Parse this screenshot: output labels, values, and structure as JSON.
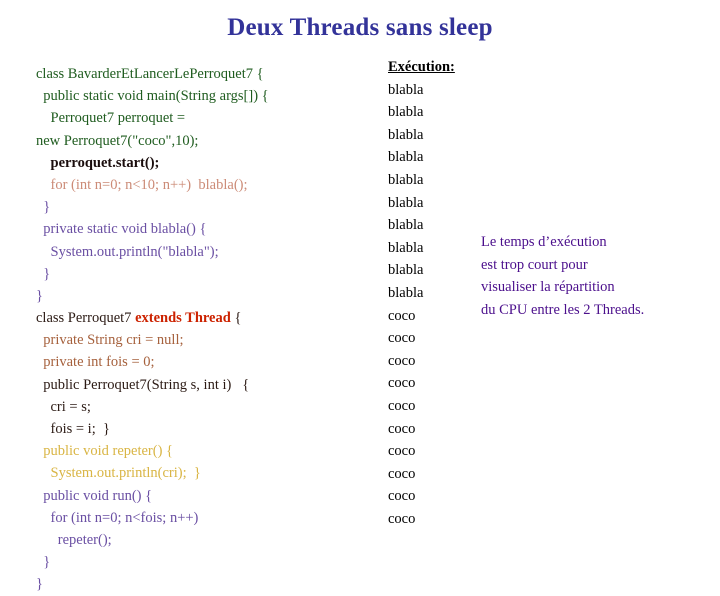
{
  "slide": {
    "title": "Deux Threads sans sleep",
    "title_color": "#333399",
    "background_color": "#ffffff"
  },
  "code": {
    "lines": [
      {
        "text": "class BavarderEtLancerLePerroquet7 {",
        "color": "#1f5c1f",
        "bold": false
      },
      {
        "text": "  public static void main(String args[]) {",
        "color": "#1f5c1f",
        "bold": false
      },
      {
        "text": "    Perroquet7 perroquet =",
        "color": "#1f5c1f",
        "bold": false
      },
      {
        "text": "new Perroquet7(\"coco\",10);",
        "color": "#1f5c1f",
        "bold": false
      },
      {
        "text": "    perroquet.start();",
        "color": "#1a0d0d",
        "bold": true
      },
      {
        "text": "    for (int n=0; n<10; n++)  blabla();",
        "color": "#cc8b77",
        "bold": false
      },
      {
        "text": "  }",
        "color": "#6a4fa3",
        "bold": false
      },
      {
        "text": "  private static void blabla() {",
        "color": "#6a4fa3",
        "bold": false
      },
      {
        "text": "    System.out.println(\"blabla\");",
        "color": "#6a4fa3",
        "bold": false
      },
      {
        "text": "  }",
        "color": "#6a4fa3",
        "bold": false
      },
      {
        "text": "}",
        "color": "#6a4fa3",
        "bold": false
      },
      {
        "text": "class Perroquet7 ",
        "color": "#2b1a14",
        "bold": false
      },
      {
        "text": "  private String cri = null;",
        "color": "#a6613d",
        "bold": false
      },
      {
        "text": "  private int fois = 0;",
        "color": "#a6613d",
        "bold": false
      },
      {
        "text": "  public Perroquet7(String s, int i)   {",
        "color": "#2b1a14",
        "bold": false
      },
      {
        "text": "    cri = s;",
        "color": "#2b1a14",
        "bold": false
      },
      {
        "text": "    fois = i;  }",
        "color": "#2b1a14",
        "bold": false
      },
      {
        "text": "  public void repeter() {",
        "color": "#d9b544",
        "bold": false
      },
      {
        "text": "    System.out.println(cri);  }",
        "color": "#d9b544",
        "bold": false
      },
      {
        "text": "  public void run() {",
        "color": "#6a4fa3",
        "bold": false
      },
      {
        "text": "    for (int n=0; n<fois; n++)",
        "color": "#6a4fa3",
        "bold": false
      },
      {
        "text": "      repeter();",
        "color": "#6a4fa3",
        "bold": false
      },
      {
        "text": "  }",
        "color": "#6a4fa3",
        "bold": false
      },
      {
        "text": "}",
        "color": "#6a4fa3",
        "bold": false
      }
    ],
    "class_perroquet7_prefix": "class Perroquet7 ",
    "extends_thread_keyword": "extends Thread",
    "extends_thread_color": "#cc2200",
    "class_perroquet7_suffix": " {"
  },
  "execution": {
    "heading": "Exécution:",
    "output_lines": [
      "blabla",
      "blabla",
      "blabla",
      "blabla",
      "blabla",
      "blabla",
      "blabla",
      "blabla",
      "blabla",
      "blabla",
      "coco",
      "coco",
      "coco",
      "coco",
      "coco",
      "coco",
      "coco",
      "coco",
      "coco",
      "coco"
    ]
  },
  "annotation": {
    "color": "#4b0f8c",
    "lines": [
      "Le temps d’exécution",
      "est trop court pour",
      "visualiser la répartition",
      "du CPU entre les 2 Threads."
    ]
  }
}
